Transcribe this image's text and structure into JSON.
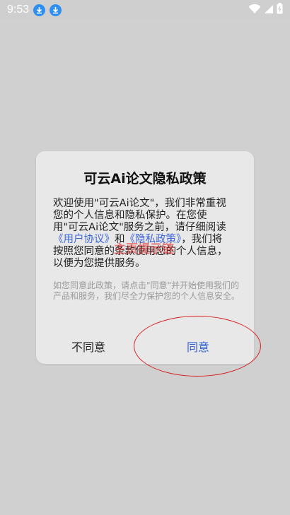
{
  "status_bar": {
    "time": "9:53",
    "icons": [
      "download-icon",
      "download-icon",
      "wifi-icon",
      "signal-icon",
      "battery-icon"
    ]
  },
  "dialog": {
    "title": "可云Ai论文隐私政策",
    "body_line1": "欢迎使用\"可云Ai论文\"，我们非常重视",
    "body_line2": "您的个人信息和隐私保护。在您使",
    "body_line3": "用\"可云Ai论文\"服务之前，请仔细阅读",
    "link_user_agreement": "《用户协议》",
    "body_and": "和",
    "link_privacy_policy": "《隐私政策》",
    "body_line4_tail": "，我们将",
    "body_line5": "按照您同意的条款使用您的个人信息，",
    "body_line6": "以便为您提供服务。",
    "note": "如您同意此政策，请点击\"同意\"并开始使用我们的产品和服务，我们尽全力保护您的个人信息安全。",
    "watermark": "主页提示链",
    "buttons": {
      "disagree": "不同意",
      "agree": "同意"
    }
  },
  "colors": {
    "link": "#3e66d9",
    "agree": "#2f5fd6",
    "annotation": "#d61f1f",
    "download_badge": "#2f8ff0"
  }
}
